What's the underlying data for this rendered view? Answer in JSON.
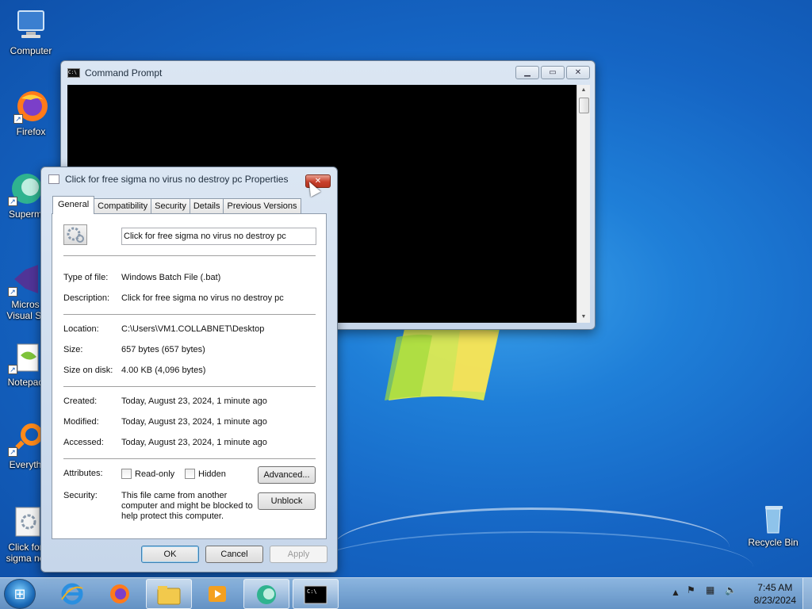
{
  "desktop": {
    "icons": [
      {
        "label": "Computer"
      },
      {
        "label": "Firefox"
      },
      {
        "label": "Superm"
      },
      {
        "label": "Micros",
        "label2": "Visual St"
      },
      {
        "label": "Notepac"
      },
      {
        "label": "Everyth"
      },
      {
        "label": "Click for",
        "label2": "sigma no"
      }
    ],
    "recycle_bin": "Recycle Bin"
  },
  "cmd_window": {
    "title": "Command Prompt"
  },
  "props_dialog": {
    "title": "Click for free sigma no virus no destroy pc Properties",
    "tabs": [
      "General",
      "Compatibility",
      "Security",
      "Details",
      "Previous Versions"
    ],
    "filename": "Click for free sigma no virus no destroy pc",
    "type_label": "Type of file:",
    "type_value": "Windows Batch File (.bat)",
    "desc_label": "Description:",
    "desc_value": "Click for free sigma no virus no destroy pc",
    "location_label": "Location:",
    "location_value": "C:\\Users\\VM1.COLLABNET\\Desktop",
    "size_label": "Size:",
    "size_value": "657 bytes (657 bytes)",
    "size_disk_label": "Size on disk:",
    "size_disk_value": "4.00 KB (4,096 bytes)",
    "created_label": "Created:",
    "created_value": "Today, August 23, 2024, 1 minute ago",
    "modified_label": "Modified:",
    "modified_value": "Today, August 23, 2024, 1 minute ago",
    "accessed_label": "Accessed:",
    "accessed_value": "Today, August 23, 2024, 1 minute ago",
    "attributes_label": "Attributes:",
    "readonly_label": "Read-only",
    "hidden_label": "Hidden",
    "advanced_label": "Advanced...",
    "security_label": "Security:",
    "security_line1": "This file came from another",
    "security_line2": "computer and might be blocked to",
    "security_line3": "help protect this computer.",
    "unblock_label": "Unblock",
    "ok_label": "OK",
    "cancel_label": "Cancel",
    "apply_label": "Apply"
  },
  "taskbar": {
    "time": "7:45 AM",
    "date": "8/23/2024"
  }
}
